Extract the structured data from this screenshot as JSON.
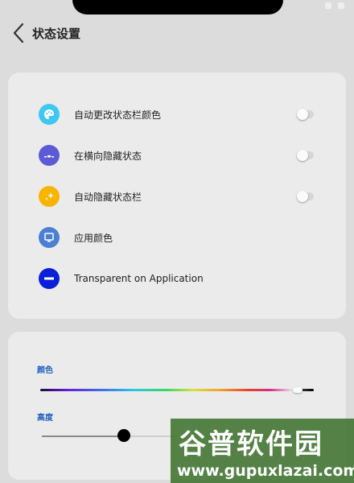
{
  "header": {
    "title": "状态设置"
  },
  "settings": [
    {
      "label": "自动更改状态栏颜色",
      "icon": "palette-icon",
      "icon_color": "#3ec7f2",
      "has_toggle": true,
      "toggle_on": false
    },
    {
      "label": "在横向隐藏状态",
      "icon": "signal-bar-icon",
      "icon_color": "#5b5bd6",
      "has_toggle": true,
      "toggle_on": false
    },
    {
      "label": "自动隐藏状态栏",
      "icon": "sparkle-icon",
      "icon_color": "#f7b500",
      "has_toggle": true,
      "toggle_on": false
    },
    {
      "label": "应用颜色",
      "icon": "monitor-icon",
      "icon_color": "#4a7fd4",
      "has_toggle": false
    },
    {
      "label": "Transparent on Application",
      "icon": "minus-circle-icon",
      "icon_color": "#0a1fd8",
      "has_toggle": false
    }
  ],
  "appearance": {
    "color_label": "颜色",
    "color_position": 0.94,
    "height_label": "高度",
    "height_value": 0.3
  },
  "watermark": {
    "brand": "谷普软件园",
    "url": "www.gupuxlazai.com"
  }
}
